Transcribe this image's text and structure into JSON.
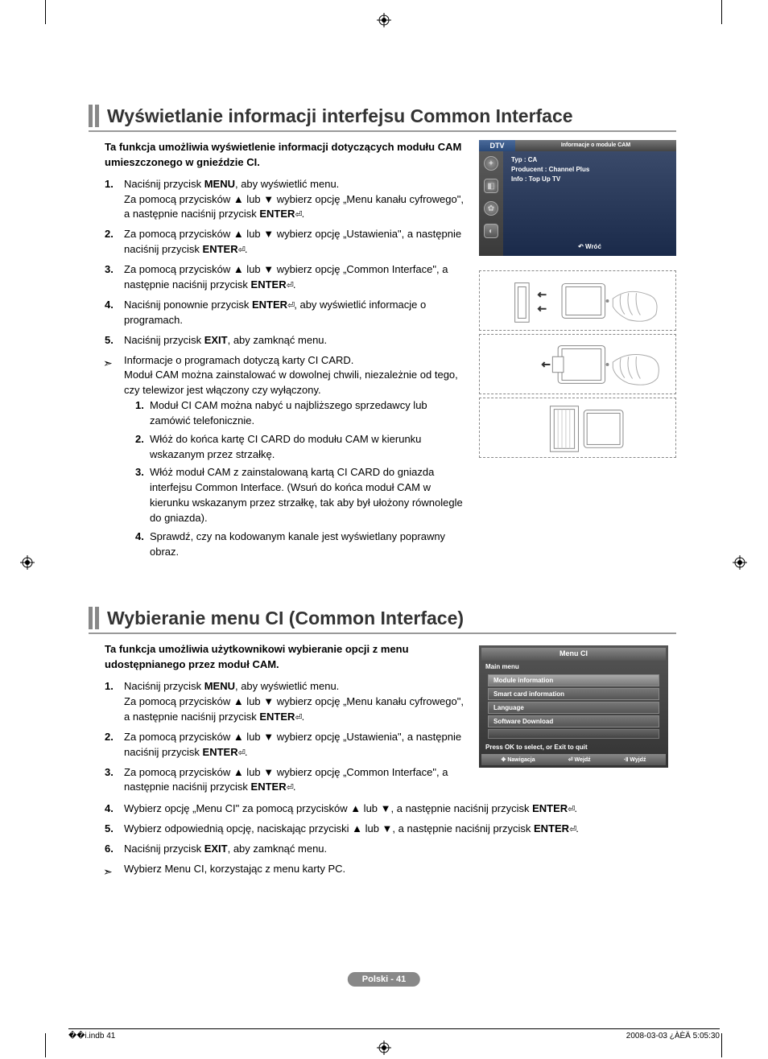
{
  "section1": {
    "heading": "Wyświetlanie informacji interfejsu Common Interface",
    "intro": "Ta funkcja umożliwia wyświetlenie informacji dotyczących modułu CAM umieszczonego w gnieździe CI.",
    "steps": {
      "s1a": "Naciśnij przycisk ",
      "s1_menu": "MENU",
      "s1b": ", aby wyświetlić menu.",
      "s1c": "Za pomocą przycisków ▲ lub ▼ wybierz opcję „Menu kanału cyfrowego\", a następnie naciśnij przycisk ",
      "enter": "ENTER",
      "s2": "Za pomocą przycisków ▲ lub ▼ wybierz opcję „Ustawienia\", a następnie naciśnij przycisk ",
      "s3": "Za pomocą przycisków ▲ lub ▼ wybierz opcję „Common Interface\", a następnie naciśnij przycisk ",
      "s4a": "Naciśnij ponownie przycisk ",
      "s4b": ", aby wyświetlić informacje o programach.",
      "s5a": "Naciśnij przycisk ",
      "s5_exit": "EXIT",
      "s5b": ", aby zamknąć menu."
    },
    "note": {
      "line1": "Informacje o programach dotyczą karty CI CARD.",
      "line2": "Moduł CAM można zainstalować w dowolnej chwili, niezależnie od tego, czy telewizor jest włączony czy wyłączony.",
      "sub1": "Moduł CI CAM można nabyć u najbliższego sprzedawcy lub zamówić telefonicznie.",
      "sub2": "Włóż do końca kartę CI CARD do modułu CAM w kierunku wskazanym przez strzałkę.",
      "sub3": "Włóż moduł CAM z zainstalowaną kartą CI CARD do gniazda interfejsu Common Interface. (Wsuń do końca moduł CAM w kierunku wskazanym przez strzałkę, tak aby był ułożony równolegle do gniazda).",
      "sub4": "Sprawdź, czy na kodowanym kanale jest wyświetlany poprawny obraz."
    }
  },
  "osd1": {
    "dtv": "DTV",
    "title": "Informacje o module CAM",
    "l1": "Typ : CA",
    "l2": "Producent : Channel Plus",
    "l3": "Info : Top Up TV",
    "return": "Wróć"
  },
  "section2": {
    "heading": "Wybieranie menu CI (Common Interface)",
    "intro": "Ta funkcja umożliwia użytkownikowi wybieranie opcji z menu udostępnianego przez moduł CAM.",
    "s4": "Wybierz opcję „Menu CI\" za pomocą przycisków ▲ lub ▼, a następnie naciśnij przycisk ",
    "s5": "Wybierz odpowiednią opcję, naciskając przyciski ▲ lub ▼, a następnie naciśnij przycisk ",
    "s6a": "Naciśnij przycisk ",
    "s6b": ", aby zamknąć menu.",
    "note": "Wybierz Menu CI, korzystając z menu karty PC."
  },
  "osd2": {
    "title": "Menu CI",
    "main": "Main menu",
    "i1": "Module information",
    "i2": "Smart card information",
    "i3": "Language",
    "i4": "Software Download",
    "hint": "Press OK to select, or Exit to quit",
    "nav": "Nawigacja",
    "enter": "Wejdź",
    "exit": "Wyjdź"
  },
  "pagenum": "Polski - 41",
  "footer_left": "��i.indb   41",
  "footer_right": "2008-03-03   ¿ÀÈÄ 5:05:30"
}
